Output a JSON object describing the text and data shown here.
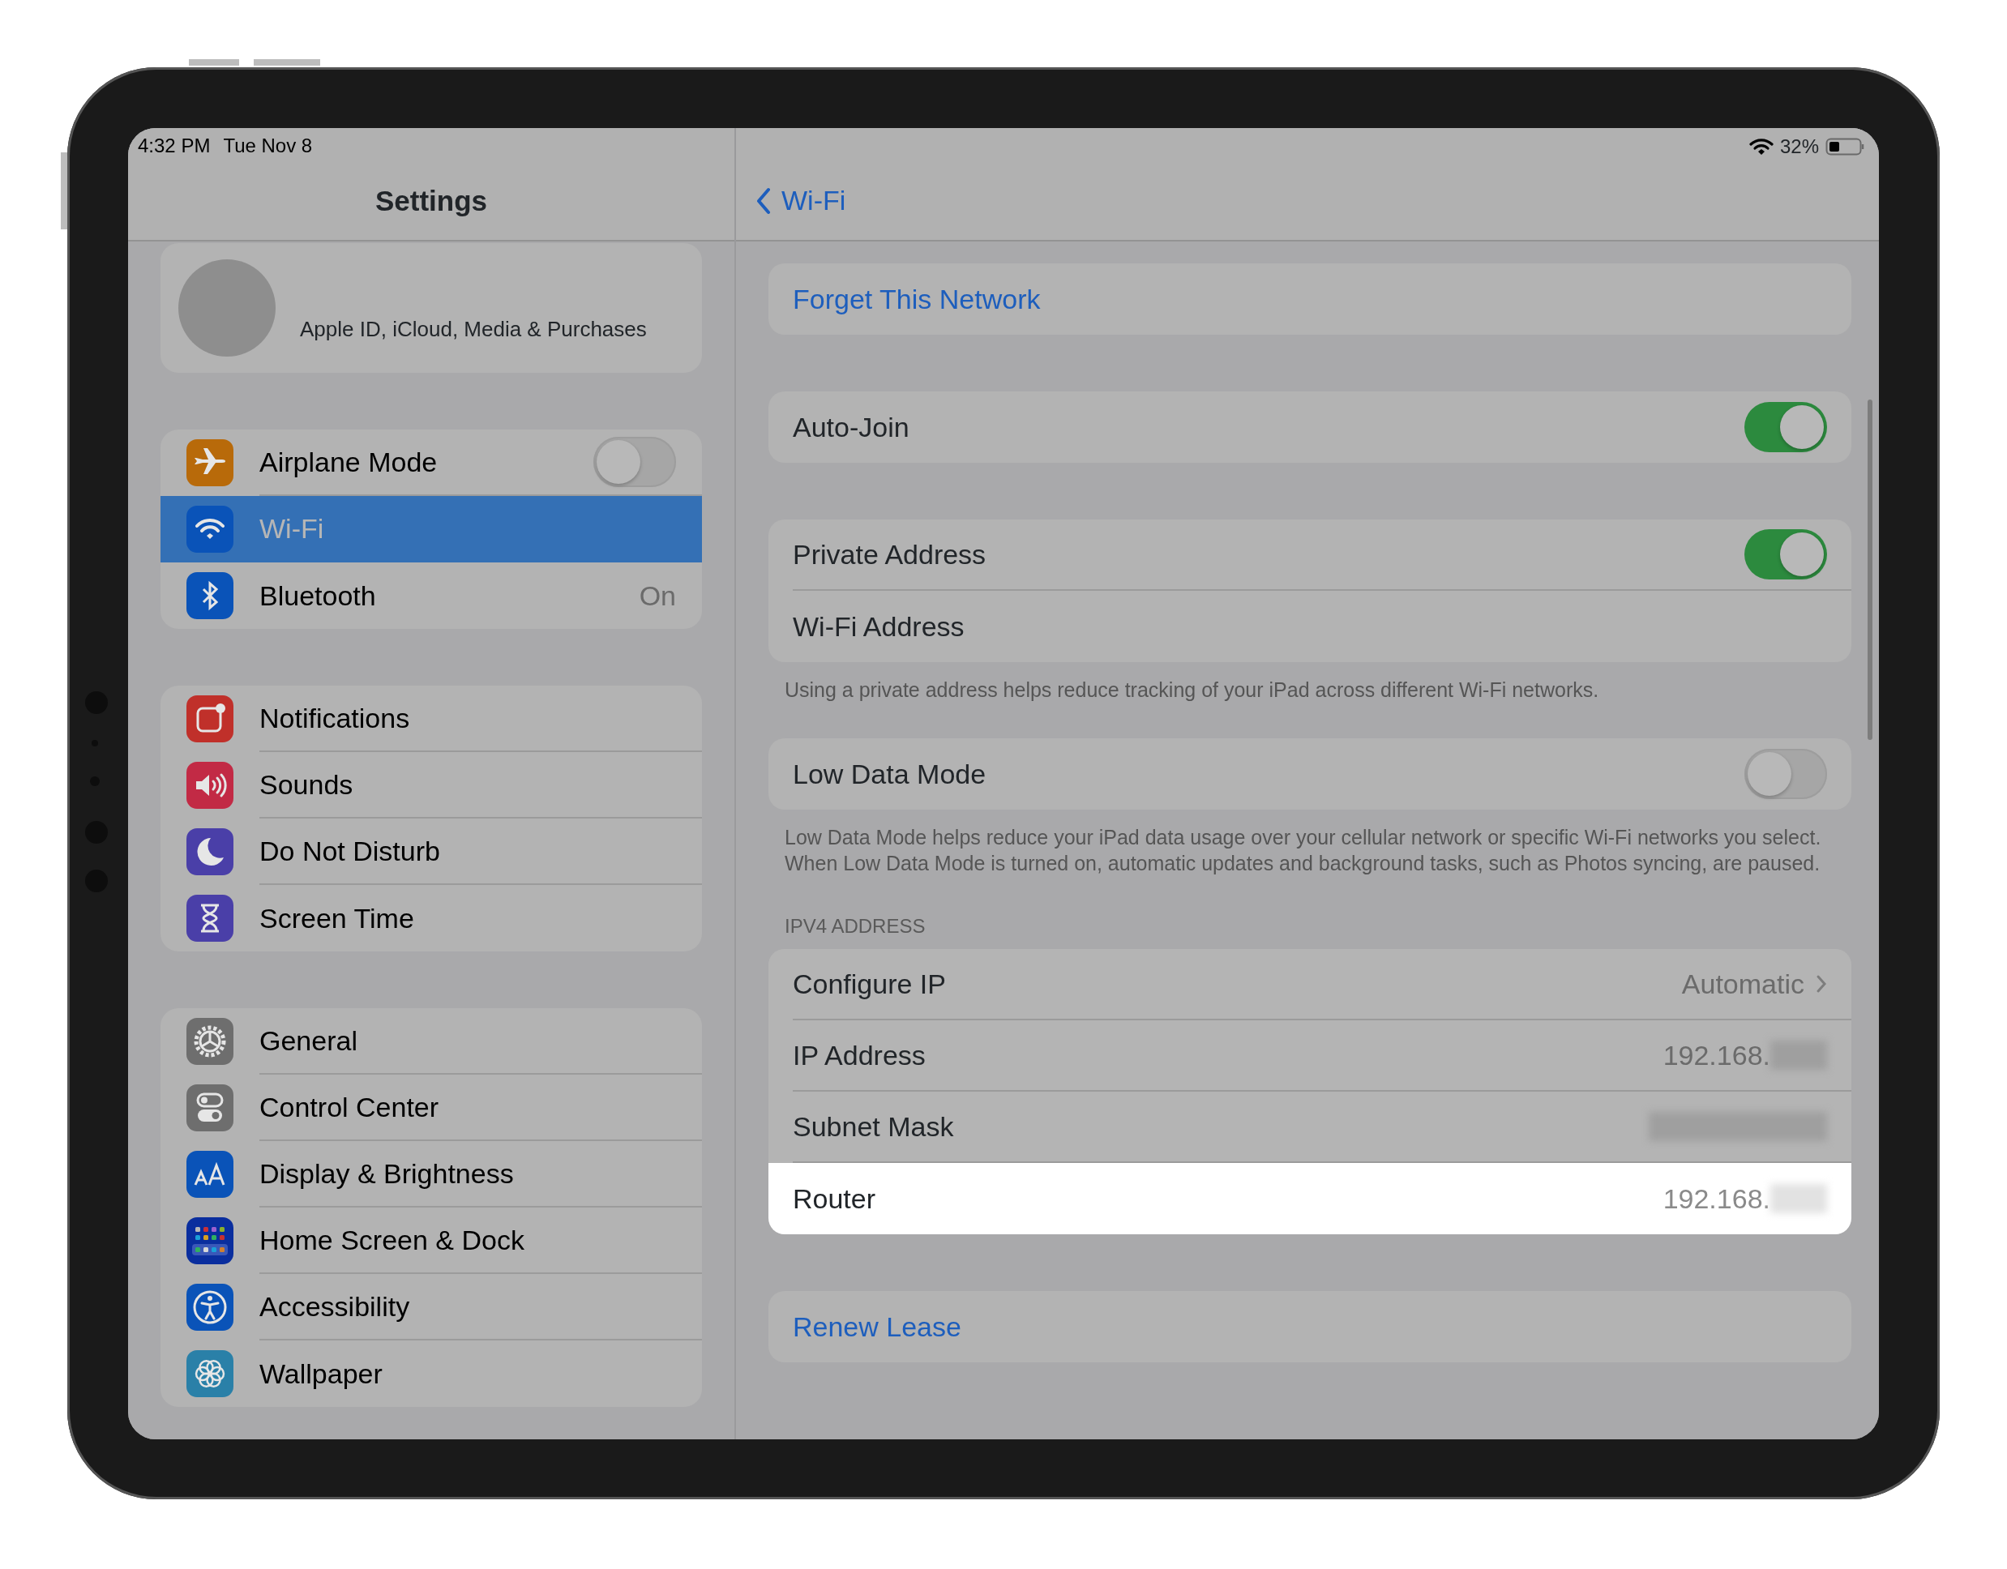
{
  "status_bar": {
    "time": "4:32 PM",
    "date": "Tue Nov 8",
    "battery": "32%"
  },
  "sidebar": {
    "title": "Settings",
    "profile": {
      "label": "Apple ID, iCloud, Media & Purchases"
    },
    "groups": [
      [
        {
          "label": "Airplane Mode",
          "kind": "toggle",
          "on": false,
          "selected": false
        },
        {
          "label": "Wi-Fi",
          "kind": "link",
          "selected": true
        },
        {
          "label": "Bluetooth",
          "kind": "value",
          "value": "On",
          "selected": false
        }
      ],
      [
        {
          "label": "Notifications",
          "kind": "link",
          "selected": false
        },
        {
          "label": "Sounds",
          "kind": "link",
          "selected": false
        },
        {
          "label": "Do Not Disturb",
          "kind": "link",
          "selected": false
        },
        {
          "label": "Screen Time",
          "kind": "link",
          "selected": false
        }
      ],
      [
        {
          "label": "General",
          "kind": "link",
          "selected": false
        },
        {
          "label": "Control Center",
          "kind": "link",
          "selected": false
        },
        {
          "label": "Display & Brightness",
          "kind": "link",
          "selected": false
        },
        {
          "label": "Home Screen & Dock",
          "kind": "link",
          "selected": false
        },
        {
          "label": "Accessibility",
          "kind": "link",
          "selected": false
        },
        {
          "label": "Wallpaper",
          "kind": "link",
          "selected": false
        }
      ]
    ]
  },
  "detail": {
    "back": "Wi-Fi",
    "sections": [
      {
        "rows": [
          {
            "kind": "action",
            "label": "Forget This Network"
          }
        ]
      },
      {
        "rows": [
          {
            "kind": "toggle",
            "label": "Auto-Join",
            "on": true
          }
        ]
      },
      {
        "rows": [
          {
            "kind": "toggle",
            "label": "Private Address",
            "on": true
          },
          {
            "kind": "plain",
            "label": "Wi-Fi Address"
          }
        ],
        "note": "Using a private address helps reduce tracking of your iPad across different Wi-Fi networks."
      },
      {
        "rows": [
          {
            "kind": "toggle",
            "label": "Low Data Mode",
            "on": false
          }
        ],
        "note": "Low Data Mode helps reduce your iPad data usage over your cellular network or specific Wi-Fi networks you select. When Low Data Mode is turned on, automatic updates and background tasks, such as Photos syncing, are paused."
      },
      {
        "header": "IPV4 ADDRESS",
        "rows": [
          {
            "kind": "value",
            "label": "Configure IP",
            "value": "Automatic",
            "selected": false
          },
          {
            "kind": "redacted",
            "label": "IP Address",
            "value": "192.168.",
            "selected": false
          },
          {
            "kind": "redacted",
            "label": "Subnet Mask",
            "selected": false
          },
          {
            "kind": "redacted",
            "label": "Router",
            "value": "192.168.",
            "selected": true
          }
        ]
      },
      {
        "rows": [
          {
            "kind": "action",
            "label": "Renew Lease"
          }
        ]
      }
    ]
  }
}
